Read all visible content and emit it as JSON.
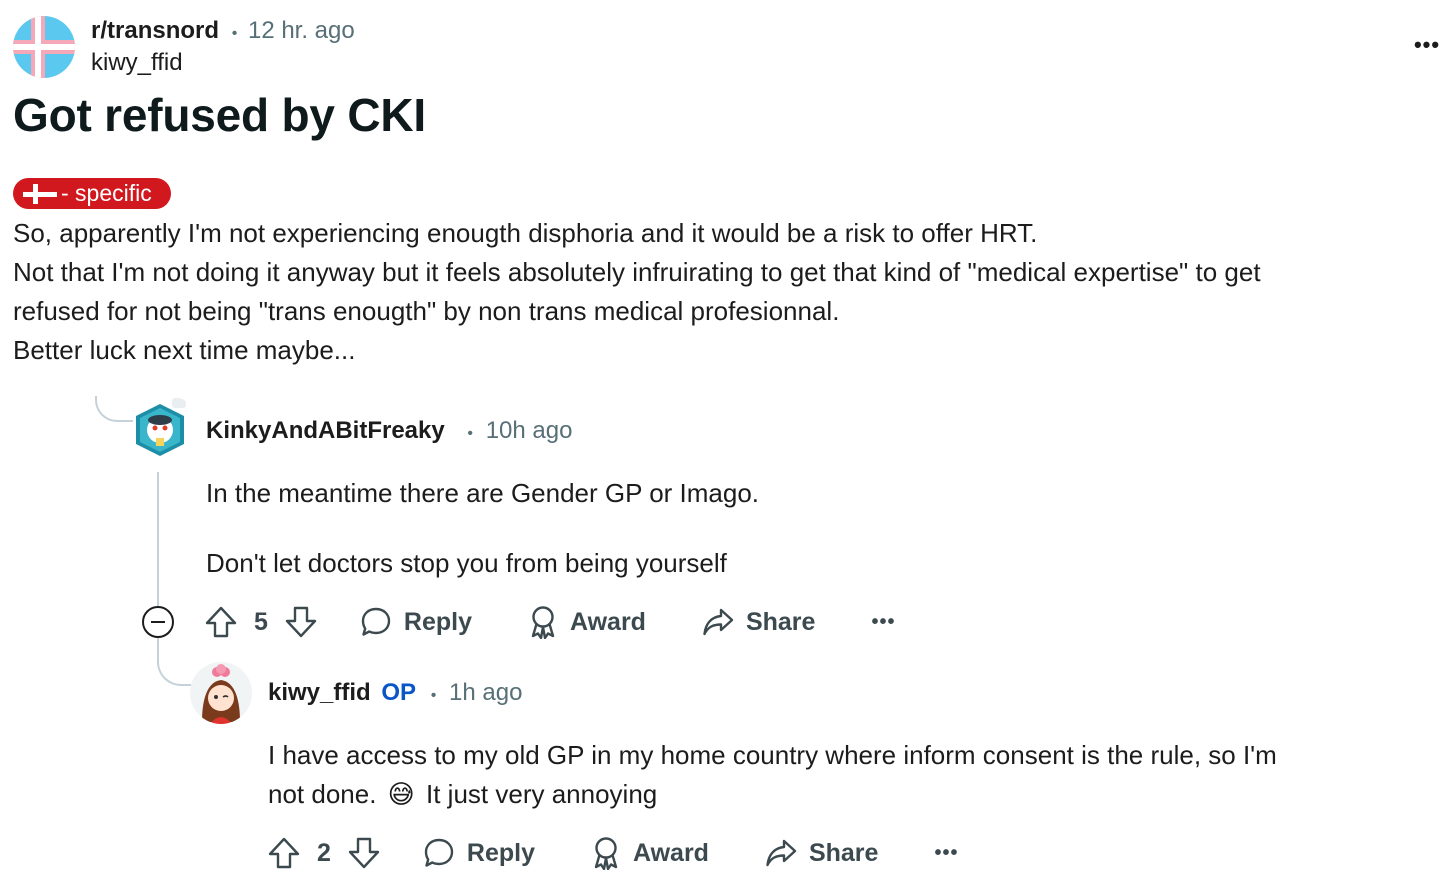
{
  "post": {
    "subreddit": "r/transnord",
    "separator": "•",
    "time": "12 hr. ago",
    "author": "kiwy_ffid",
    "more": "•••",
    "title": "Got refused by CKI",
    "flair": {
      "label": "- specific",
      "color": "#d0181e"
    },
    "body": [
      "So, apparently I'm not experiencing enougth disphoria and it would be a risk to offer HRT.",
      "Not that I'm not doing it anyway but it feels absolutely infruirating to get that kind of \"medical expertise\" to get",
      "refused for not being \"trans enougth\" by non trans medical profesionnal.",
      "Better luck next time maybe..."
    ]
  },
  "comments": [
    {
      "author": "KinkyAndABitFreaky",
      "separator": "•",
      "time": "10h ago",
      "lines": [
        "In the meantime there are Gender GP or Imago.",
        "Don't let doctors stop you from being yourself"
      ],
      "score": "5",
      "reply": "Reply",
      "award": "Award",
      "share": "Share",
      "more": "•••"
    },
    {
      "author": "kiwy_ffid",
      "op_badge": "OP",
      "separator": "•",
      "time": "1h ago",
      "lines": [
        "I have access to my old GP in my home country where inform consent is the rule,  so I'm",
        "not done."
      ],
      "emoji": "😅",
      "line2_rest": "It just very annoying",
      "score": "2",
      "reply": "Reply",
      "award": "Award",
      "share": "Share",
      "more": "•••"
    }
  ],
  "colors": {
    "accent_op": "#0a55c8",
    "meta": "#576f76",
    "thread_line": "#c5d3d8"
  }
}
